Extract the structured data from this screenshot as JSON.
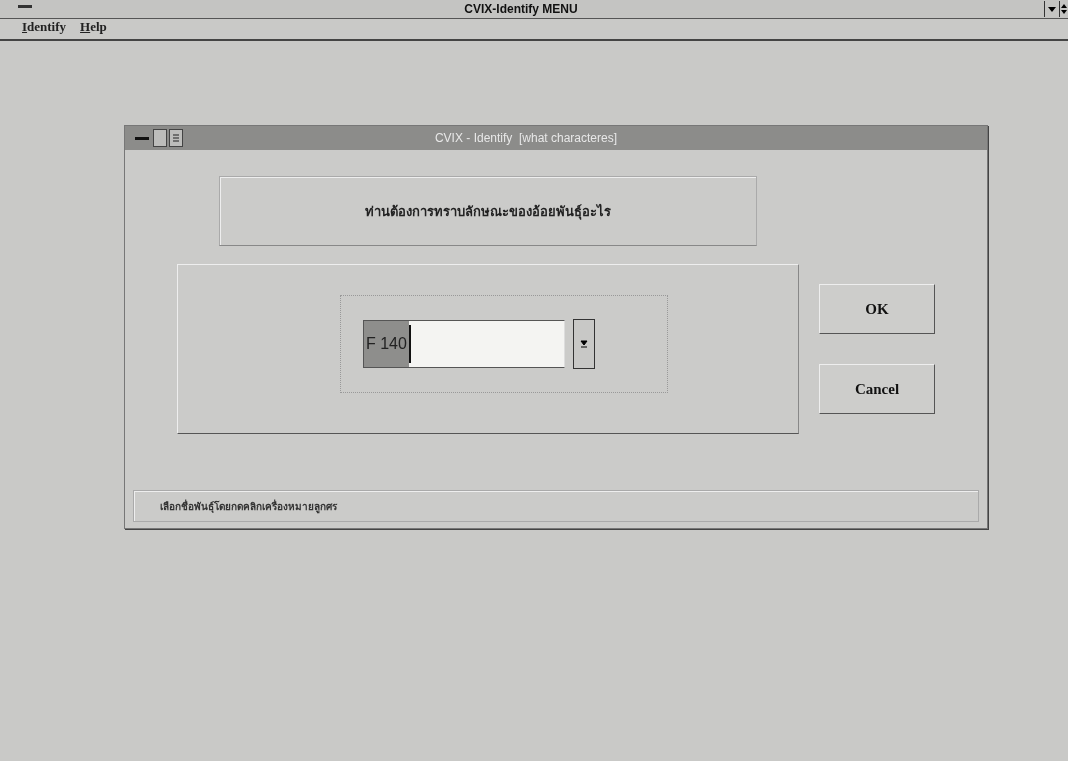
{
  "window": {
    "title": "CVIX-Identify MENU"
  },
  "menu": [
    {
      "label": "Identify",
      "underlined_first": true
    },
    {
      "label": "Help",
      "underlined_first": true
    }
  ],
  "dialog": {
    "title": "CVIX - Identify  [what characteres]",
    "prompt": "ท่านต้องการทราบลักษณะของอ้อยพันธุ์อะไร",
    "combo": {
      "value": "F 140",
      "highlighted": true
    },
    "buttons": [
      {
        "label": "OK"
      },
      {
        "label": "Cancel"
      }
    ],
    "status": "เลือกชื่อพันธุ์โดยกดคลิกเครื่องหมายลูกศร"
  }
}
